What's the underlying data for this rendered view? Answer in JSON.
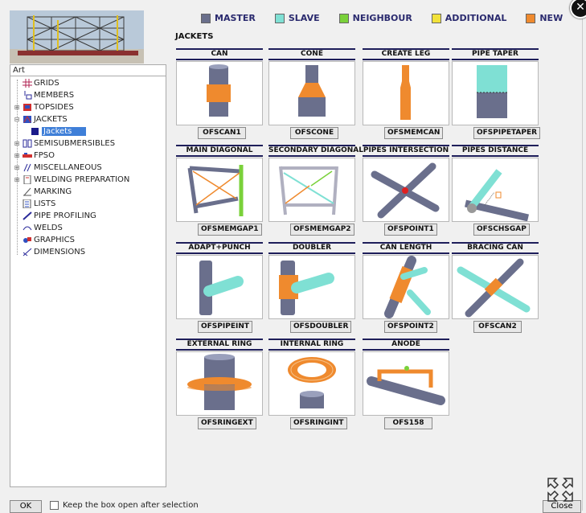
{
  "legend": [
    {
      "label": "MASTER",
      "color": "#6a6f8c"
    },
    {
      "label": "SLAVE",
      "color": "#7fe0d4"
    },
    {
      "label": "NEIGHBOUR",
      "color": "#7ad13a"
    },
    {
      "label": "ADDITIONAL",
      "color": "#f2e23a"
    },
    {
      "label": "NEW",
      "color": "#ef8a2e"
    }
  ],
  "tree": {
    "root": "Art",
    "items": [
      {
        "label": "GRIDS",
        "icon": "grid-icon"
      },
      {
        "label": "MEMBERS",
        "icon": "members-icon"
      },
      {
        "label": "TOPSIDES",
        "icon": "topsides-icon"
      },
      {
        "label": "JACKETS",
        "icon": "jackets-icon"
      },
      {
        "label": "Jackets",
        "icon": "jacket-square-icon"
      },
      {
        "label": "SEMISUBMERSIBLES",
        "icon": "semisub-icon"
      },
      {
        "label": "FPSO",
        "icon": "fpso-icon"
      },
      {
        "label": "MISCELLANEOUS",
        "icon": "misc-icon"
      },
      {
        "label": "WELDING PREPARATION",
        "icon": "welding-icon"
      },
      {
        "label": "MARKING",
        "icon": "marking-icon"
      },
      {
        "label": "LISTS",
        "icon": "lists-icon"
      },
      {
        "label": "PIPE PROFILING",
        "icon": "pipe-profiling-icon"
      },
      {
        "label": "WELDS",
        "icon": "welds-icon"
      },
      {
        "label": "GRAPHICS",
        "icon": "graphics-icon"
      },
      {
        "label": "DIMENSIONS",
        "icon": "dimensions-icon"
      }
    ]
  },
  "section_title": "JACKETS",
  "cells": [
    {
      "title": "CAN",
      "button": "OFSCAN1"
    },
    {
      "title": "CONE",
      "button": "OFSCONE"
    },
    {
      "title": "CREATE LEG",
      "button": "OFSMEMCAN"
    },
    {
      "title": "PIPE TAPER",
      "button": "OFSPIPETAPER"
    },
    {
      "title": "MAIN DIAGONAL",
      "button": "OFSMEMGAP1"
    },
    {
      "title": "SECONDARY DIAGONAL",
      "button": "OFSMEMGAP2"
    },
    {
      "title": "PIPES INTERSECTION",
      "button": "OFSPOINT1"
    },
    {
      "title": "PIPES DISTANCE",
      "button": "OFSCHSGAP"
    },
    {
      "title": "ADAPT+PUNCH",
      "button": "OFSPIPEINT"
    },
    {
      "title": "DOUBLER",
      "button": "OFSDOUBLER"
    },
    {
      "title": "CAN LENGTH",
      "button": "OFSPOINT2"
    },
    {
      "title": "BRACING CAN",
      "button": "OFSCAN2"
    },
    {
      "title": "EXTERNAL RING",
      "button": "OFSRINGEXT"
    },
    {
      "title": "INTERNAL RING",
      "button": "OFSRINGINT"
    },
    {
      "title": "ANODE",
      "button": "OFS158"
    }
  ],
  "footer": {
    "ok_label": "OK",
    "keep_open_label": "Keep the box open after selection",
    "close_label": "Close"
  }
}
